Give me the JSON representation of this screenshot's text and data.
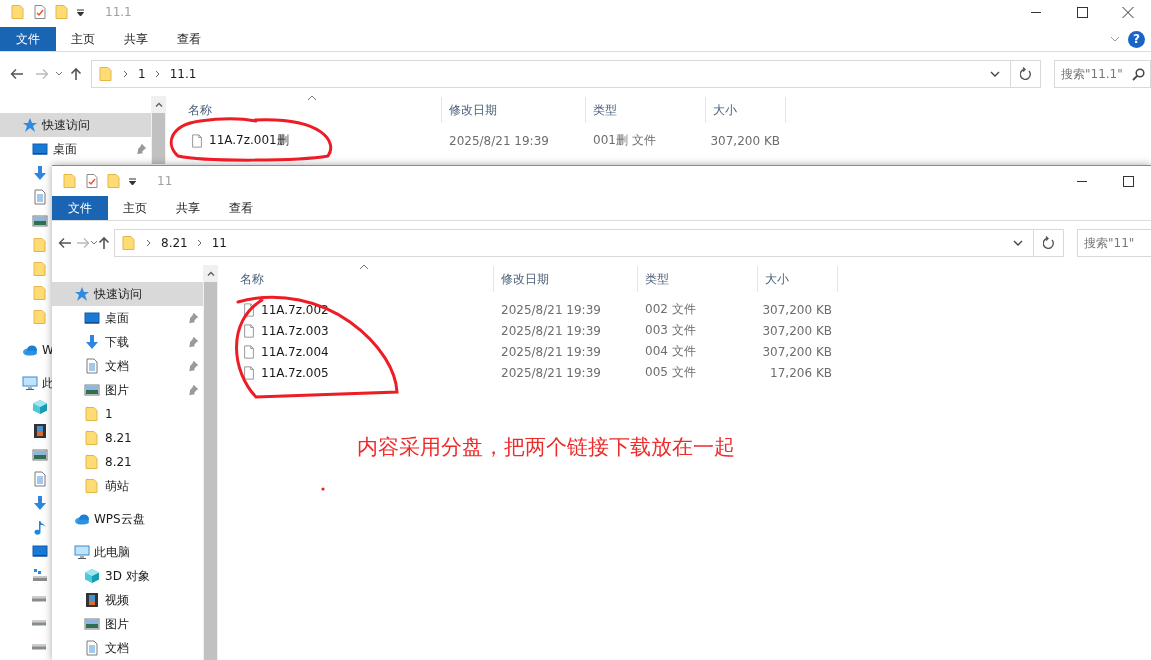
{
  "windows": [
    {
      "title": "11.1",
      "window_buttons": [
        {
          "kind": "minimize"
        },
        {
          "kind": "maximize"
        },
        {
          "kind": "close"
        }
      ],
      "ribbon_tabs": [
        {
          "label": "文件",
          "selected": true
        },
        {
          "label": "主页",
          "selected": false
        },
        {
          "label": "共享",
          "selected": false
        },
        {
          "label": "查看",
          "selected": false
        }
      ],
      "help_button": "?",
      "breadcrumb": [
        "1",
        "11.1"
      ],
      "search": {
        "placeholder": "搜索\"11.1\""
      },
      "sidebar": [
        {
          "label": "快速访问",
          "kind": "star",
          "selected": true,
          "children": [
            {
              "label": "桌面",
              "kind": "desktop",
              "selected": false,
              "pinned": true
            },
            {
              "kind": "download",
              "selected": false
            },
            {
              "kind": "doc",
              "selected": false
            },
            {
              "kind": "picture",
              "selected": false
            },
            {
              "kind": "folder",
              "selected": false
            },
            {
              "kind": "folder",
              "selected": false
            },
            {
              "kind": "folder",
              "selected": false
            },
            {
              "kind": "folder",
              "selected": false
            }
          ]
        },
        {
          "label": "W",
          "kind": "cloud",
          "selected": false
        },
        {
          "label": "此",
          "kind": "pc",
          "selected": false,
          "children": [
            {
              "kind": "cube",
              "selected": false
            },
            {
              "kind": "video",
              "selected": false
            },
            {
              "kind": "picture",
              "selected": false
            },
            {
              "kind": "doc",
              "selected": false
            },
            {
              "kind": "download",
              "selected": false
            },
            {
              "kind": "music",
              "selected": false
            },
            {
              "kind": "desktop",
              "selected": false
            },
            {
              "kind": "netdrive",
              "selected": false
            },
            {
              "kind": "drive",
              "selected": false
            },
            {
              "kind": "drive",
              "selected": false
            },
            {
              "kind": "drive",
              "selected": false
            }
          ]
        }
      ],
      "columns": [
        "名称",
        "修改日期",
        "类型",
        "大小"
      ],
      "files": [
        {
          "name": "11A.7z.001删",
          "modified": "2025/8/21 19:39",
          "type": "001删 文件",
          "size": "307,200 KB"
        }
      ]
    },
    {
      "title": "11",
      "window_buttons": [
        {
          "kind": "minimize"
        },
        {
          "kind": "maximize"
        }
      ],
      "ribbon_tabs": [
        {
          "label": "文件",
          "selected": true
        },
        {
          "label": "主页",
          "selected": false
        },
        {
          "label": "共享",
          "selected": false
        },
        {
          "label": "查看",
          "selected": false
        }
      ],
      "breadcrumb": [
        "8.21",
        "11"
      ],
      "search": {
        "placeholder": "搜索\"11\""
      },
      "sidebar": [
        {
          "label": "快速访问",
          "kind": "star",
          "selected": true,
          "children": [
            {
              "label": "桌面",
              "kind": "desktop",
              "selected": false,
              "pinned": true
            },
            {
              "label": "下载",
              "kind": "download",
              "selected": false,
              "pinned": true
            },
            {
              "label": "文档",
              "kind": "doc",
              "selected": false,
              "pinned": true
            },
            {
              "label": "图片",
              "kind": "picture",
              "selected": false,
              "pinned": true
            },
            {
              "label": "1",
              "kind": "folder",
              "selected": false,
              "pinned": false
            },
            {
              "label": "8.21",
              "kind": "folder",
              "selected": false,
              "pinned": false
            },
            {
              "label": "8.21",
              "kind": "folder",
              "selected": false,
              "pinned": false
            },
            {
              "label": "萌站",
              "kind": "folder",
              "selected": false,
              "pinned": false
            }
          ]
        },
        {
          "label": "WPS云盘",
          "kind": "cloud",
          "selected": false
        },
        {
          "label": "此电脑",
          "kind": "pc",
          "selected": false,
          "children": [
            {
              "label": "3D 对象",
              "kind": "cube",
              "selected": false
            },
            {
              "label": "视频",
              "kind": "video",
              "selected": false
            },
            {
              "label": "图片",
              "kind": "picture",
              "selected": false
            },
            {
              "label": "文档",
              "kind": "doc",
              "selected": false
            }
          ]
        }
      ],
      "columns": [
        "名称",
        "修改日期",
        "类型",
        "大小"
      ],
      "files": [
        {
          "name": "11A.7z.002",
          "modified": "2025/8/21 19:39",
          "type": "002 文件",
          "size": "307,200 KB"
        },
        {
          "name": "11A.7z.003",
          "modified": "2025/8/21 19:39",
          "type": "003 文件",
          "size": "307,200 KB"
        },
        {
          "name": "11A.7z.004",
          "modified": "2025/8/21 19:39",
          "type": "004 文件",
          "size": "307,200 KB"
        },
        {
          "name": "11A.7z.005",
          "modified": "2025/8/21 19:39",
          "type": "005 文件",
          "size": "17,206 KB"
        }
      ]
    }
  ],
  "annotation": {
    "note": "内容采用分盘，把两个链接下载放在一起"
  }
}
